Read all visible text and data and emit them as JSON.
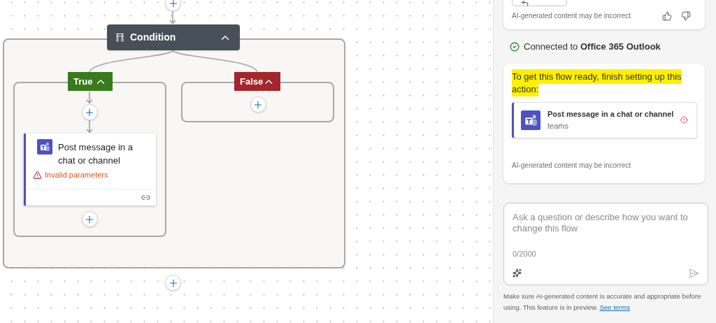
{
  "flow": {
    "condition": {
      "title": "Condition",
      "expanded": true
    },
    "branches": [
      {
        "kind": "true",
        "label": "True",
        "expanded": true,
        "actions": [
          {
            "title": "Post message in a chat or channel",
            "error": "Invalid parameters"
          }
        ]
      },
      {
        "kind": "false",
        "label": "False",
        "expanded": true
      }
    ]
  },
  "panel": {
    "previous_message": {
      "note": "AI-generated content may be incorrect"
    },
    "connection": {
      "text": "Connected to **Office 365 Outlook**"
    },
    "message": {
      "text": "To get this flow ready, finish setting up this action:",
      "highlighted": true,
      "action": {
        "title": "Post message in a chat or channel",
        "connector": "teams"
      },
      "note": "AI-generated content may be incorrect"
    },
    "composer": {
      "placeholder": "Ask a question or describe how you want to change this flow",
      "counter": "0/2000"
    },
    "disclaimer": {
      "text": "Make sure AI-generated content is accurate and appropriate before using. This feature is in preview.",
      "link": "See terms"
    }
  }
}
